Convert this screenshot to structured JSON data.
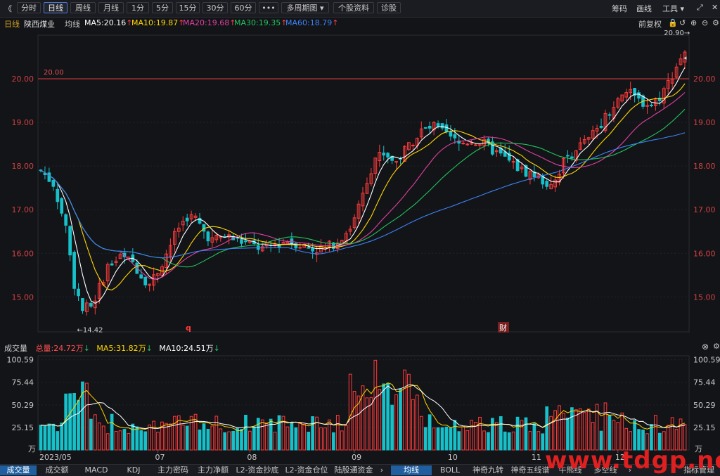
{
  "toolbar": {
    "collapse": "《",
    "periods": [
      "分时",
      "日线",
      "周线",
      "月线",
      "1分",
      "5分",
      "15分",
      "30分",
      "60分",
      "•••",
      "多周期图",
      "个股资料",
      "诊股"
    ],
    "active_period": "日线",
    "right_items": [
      "筹码",
      "画线",
      "工具"
    ]
  },
  "infobar": {
    "period": "日线",
    "stock_name": "陕西煤业",
    "ma_label": "均线",
    "ma5": "MA5:20.16",
    "ma10": "MA10:19.87",
    "ma20": "MA20:19.68",
    "ma30": "MA30:19.35",
    "ma60": "MA60:18.79",
    "adjust": "前复权"
  },
  "colors": {
    "up": "#ff3b3b",
    "down": "#17c1c9",
    "ma5": "#ffffff",
    "ma10": "#ffd700",
    "ma20": "#e040a0",
    "ma30": "#22c55e",
    "ma60": "#3b82f6",
    "hline": "#d43a3a"
  },
  "price_chart": {
    "hline_value": "20.00",
    "high_label": "20.90",
    "low_label": "14.42",
    "marker_q": "q",
    "marker_cai": "财",
    "y_ticks": [
      "20.00",
      "19.00",
      "18.00",
      "17.00",
      "16.00",
      "15.00"
    ]
  },
  "volume_panel": {
    "title": "成交量",
    "total": "总量:24.72万",
    "ma5": "MA5:31.82万",
    "ma10": "MA10:24.51万",
    "y_ticks": [
      "100.59",
      "75.44",
      "50.29",
      "25.15"
    ],
    "unit": "万",
    "x_labels": [
      "2023/05",
      "07",
      "08",
      "09",
      "10",
      "11",
      "12"
    ]
  },
  "bottom_tabs": {
    "left": [
      "成交量",
      "成交额",
      "MACD",
      "KDJ",
      "主力密码",
      "主力净额",
      "L2-资金抄底",
      "L2-资金仓位",
      "陆股通资金"
    ],
    "right": [
      "均线",
      "BOLL",
      "神奇九转",
      "神奇五线谱",
      "牛熊线",
      "多空线",
      "指标管理"
    ],
    "active_left": "成交量",
    "active_right": "均线"
  },
  "watermark": "www.tdgp.net"
}
